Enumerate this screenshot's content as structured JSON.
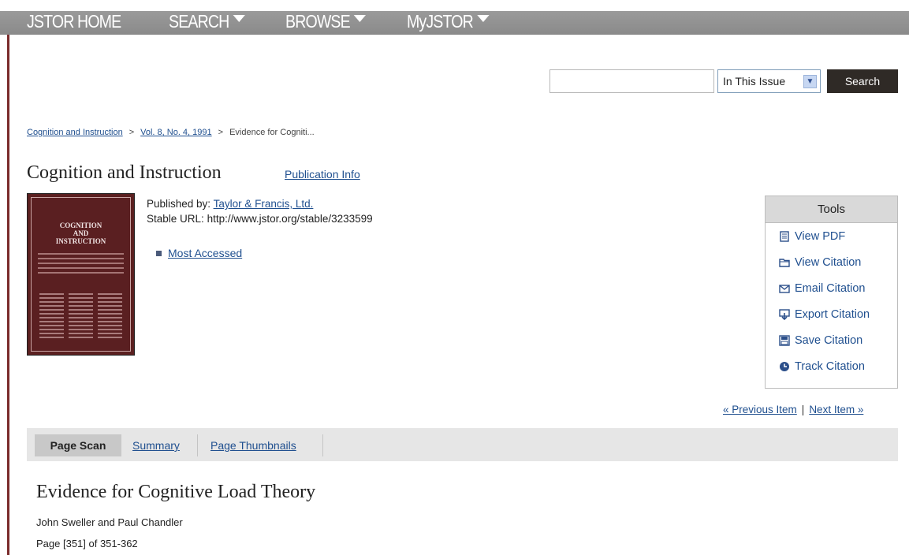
{
  "nav": {
    "items": [
      {
        "label": "JSTOR HOME",
        "has_menu": false
      },
      {
        "label": "SEARCH",
        "has_menu": true
      },
      {
        "label": "BROWSE",
        "has_menu": true
      },
      {
        "label": "MyJSTOR",
        "has_menu": true
      }
    ]
  },
  "search": {
    "value": "",
    "scope": "In This Issue",
    "button_label": "Search"
  },
  "breadcrumb": {
    "journal": "Cognition and Instruction",
    "issue": "Vol. 8, No. 4, 1991",
    "current": "Evidence for Cogniti...",
    "separator": ">"
  },
  "journal": {
    "title": "Cognition and Instruction",
    "pub_info_link": "Publication Info",
    "published_by_label": "Published by:",
    "publisher": "Taylor & Francis, Ltd.",
    "stable_url_label": "Stable URL:",
    "stable_url": "http://www.jstor.org/stable/3233599",
    "most_accessed": "Most Accessed",
    "cover_text": "COGNITION AND INSTRUCTION"
  },
  "tools": {
    "header": "Tools",
    "items": [
      {
        "label": "View PDF",
        "icon": "document-icon"
      },
      {
        "label": "View Citation",
        "icon": "folder-icon"
      },
      {
        "label": "Email Citation",
        "icon": "envelope-icon"
      },
      {
        "label": "Export Citation",
        "icon": "export-icon"
      },
      {
        "label": "Save Citation",
        "icon": "save-icon"
      },
      {
        "label": "Track Citation",
        "icon": "clock-icon"
      }
    ]
  },
  "pager": {
    "previous": "« Previous Item",
    "next": "Next Item »",
    "divider": "|"
  },
  "tabs": {
    "page_scan": "Page Scan",
    "summary": "Summary",
    "thumbnails": "Page Thumbnails"
  },
  "article": {
    "title": "Evidence for Cognitive Load Theory",
    "authors": "John Sweller and Paul Chandler",
    "pages": "Page [351] of 351-362"
  },
  "colors": {
    "nav_bar": "#8f8f8f",
    "left_rule": "#7a2b2b",
    "link": "#1f4f8f",
    "search_button": "#2f2a26"
  }
}
